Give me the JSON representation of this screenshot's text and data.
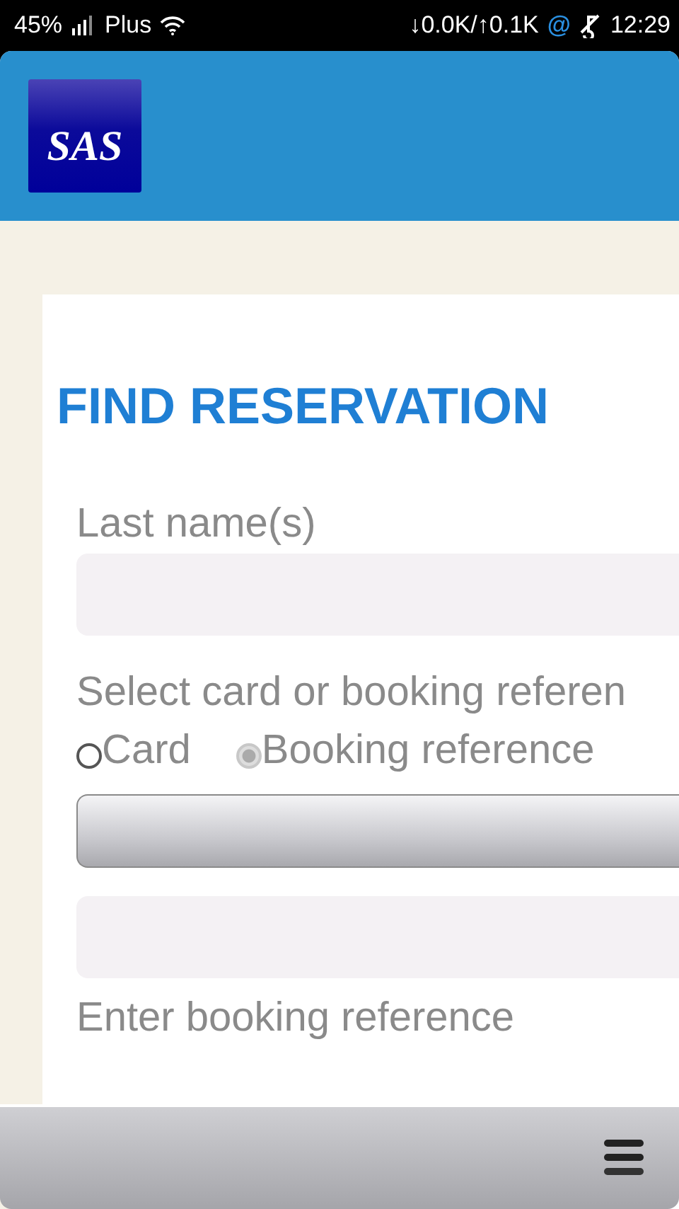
{
  "status_bar": {
    "battery": "45%",
    "carrier": "Plus",
    "traffic": "↓0.0K/↑0.1K",
    "at_sign": "@",
    "time": "12:29"
  },
  "header": {
    "logo_text": "SAS"
  },
  "form": {
    "title": "FIND RESERVATION",
    "last_name_label": "Last name(s)",
    "select_label": "Select card or booking referen",
    "options": [
      {
        "label": "Card",
        "selected": false
      },
      {
        "label": "Booking reference",
        "selected": true
      }
    ],
    "reference_label": "Enter booking reference"
  }
}
